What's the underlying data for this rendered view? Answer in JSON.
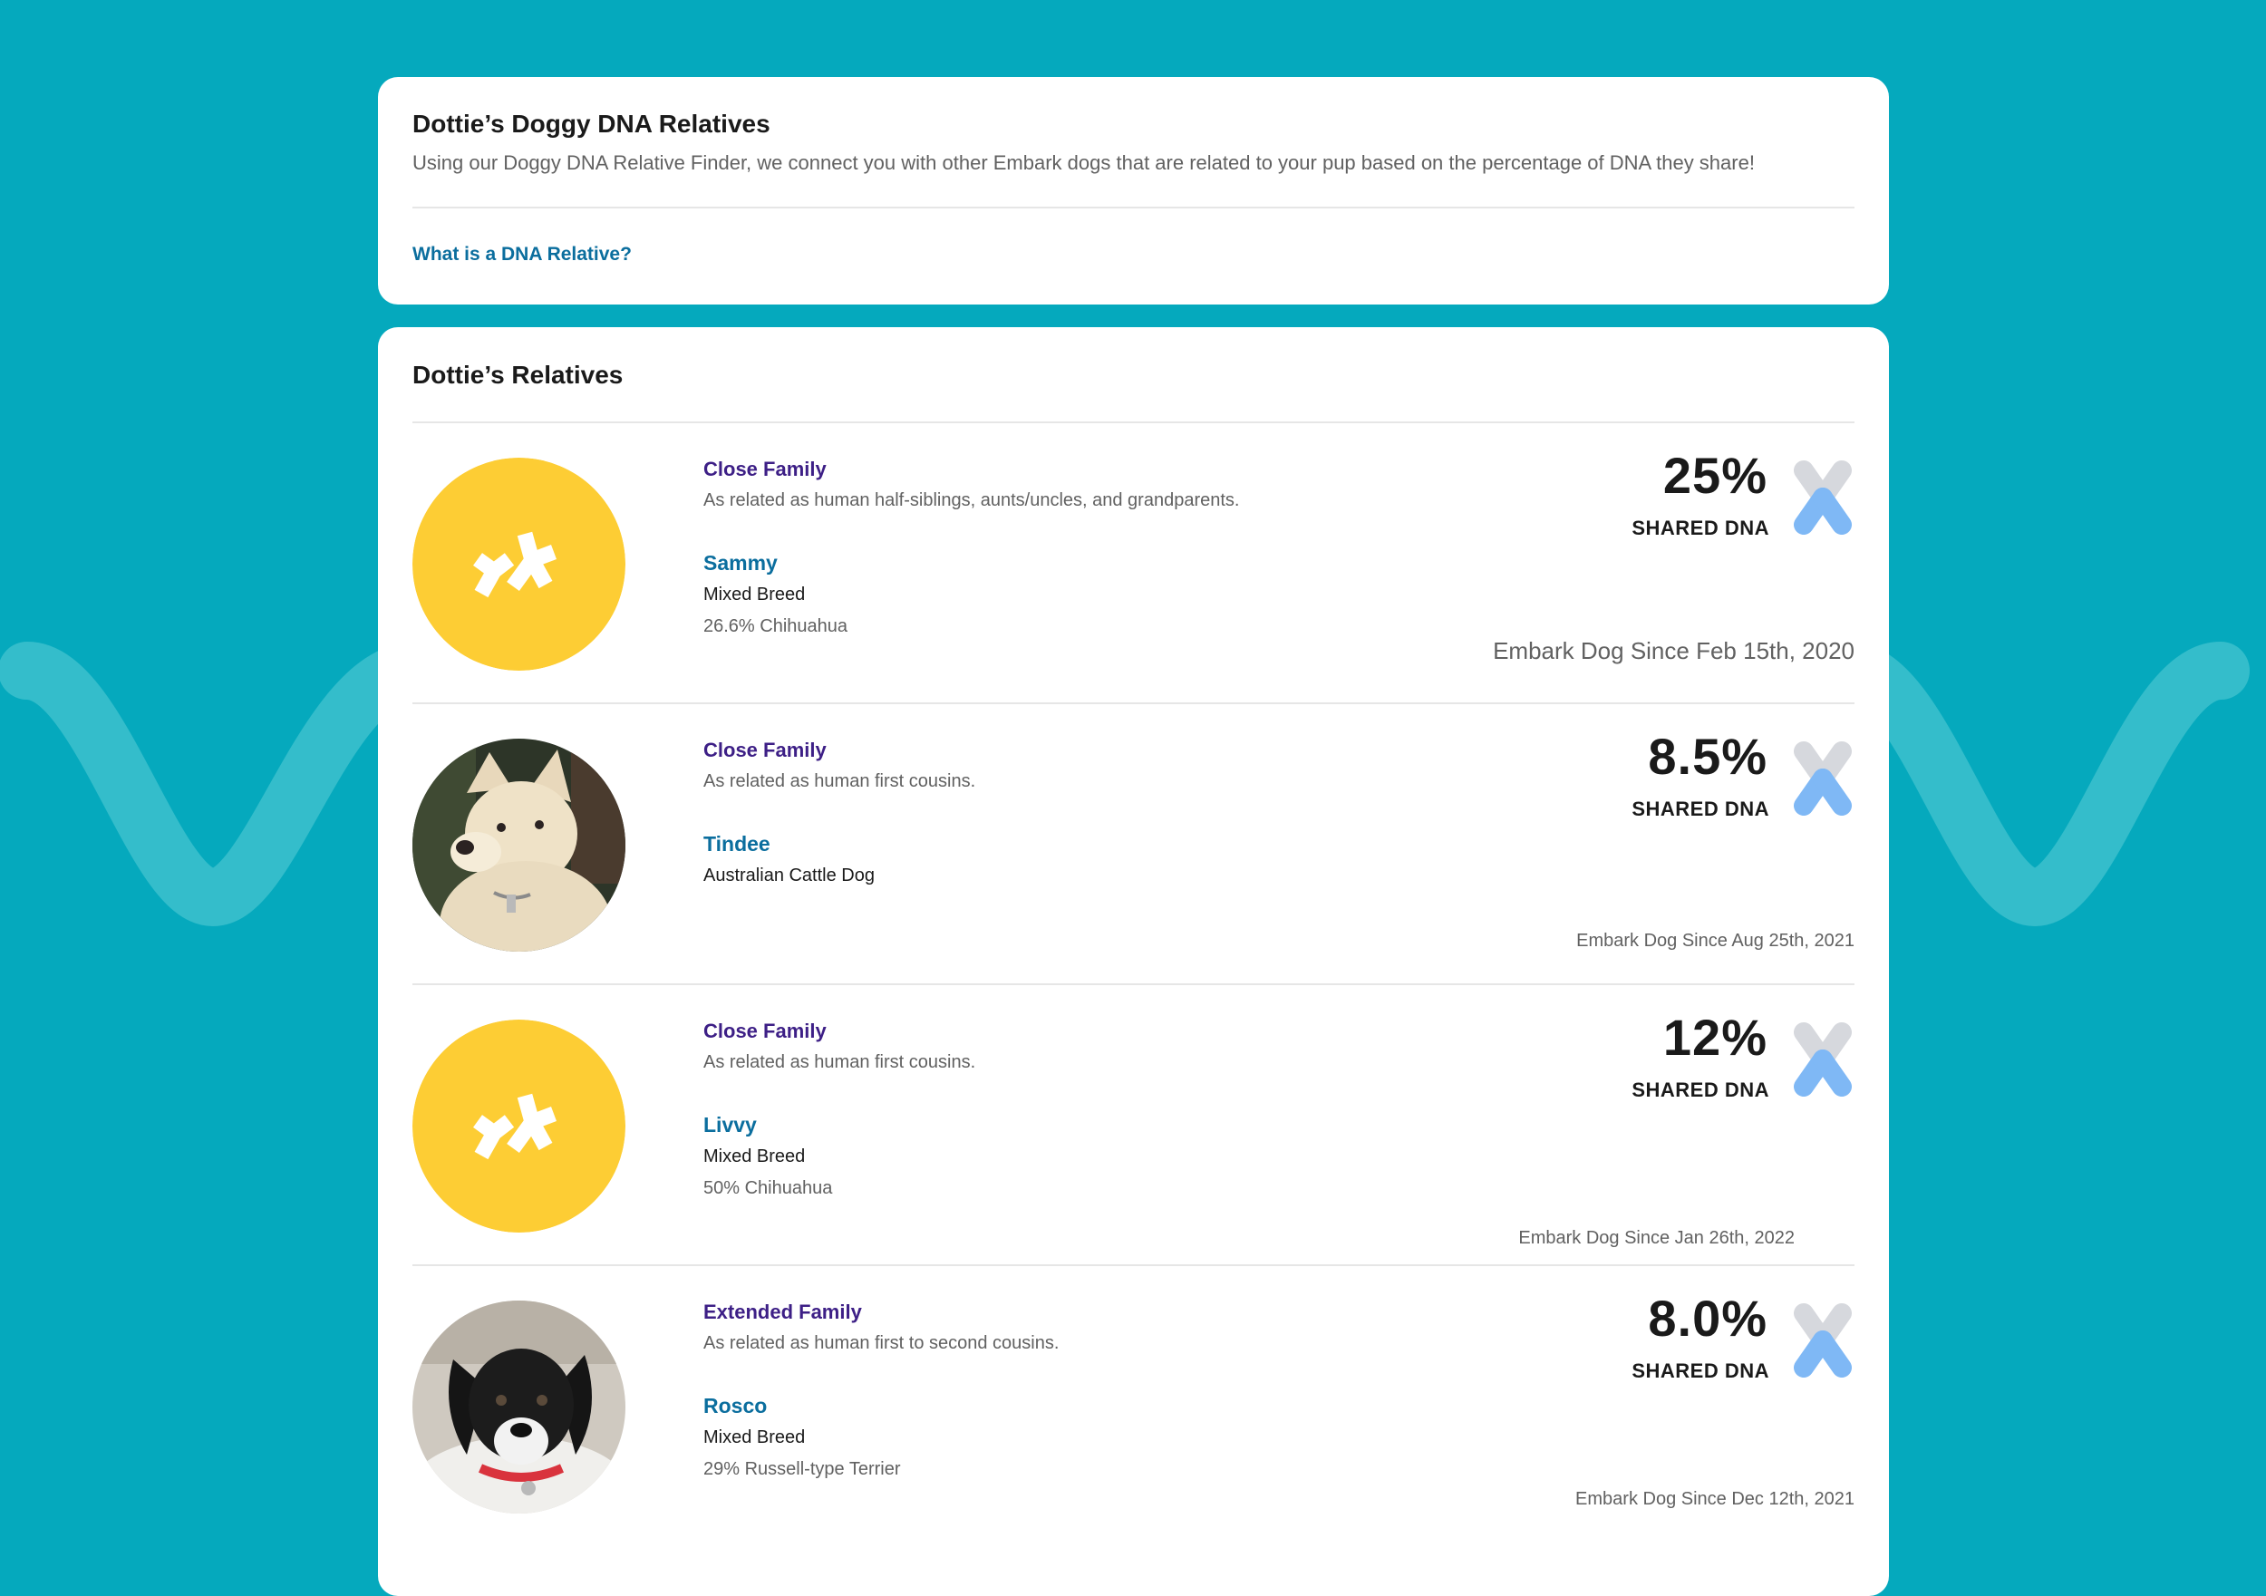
{
  "intro": {
    "title": "Dottie’s Doggy DNA Relatives",
    "description": "Using our Doggy DNA Relative Finder, we connect you with other Embark dogs that are related to your pup based on the percentage of DNA they share!",
    "link_label": "What is a DNA Relative?"
  },
  "relatives": {
    "title": "Dottie’s Relatives",
    "shared_label": "SHARED DNA",
    "items": [
      {
        "relation": "Close Family",
        "relation_desc": "As related as human half-siblings, aunts/uncles, and grandparents.",
        "name": "Sammy",
        "breed": "Mixed Breed",
        "breed_detail": "26.6% Chihuahua",
        "shared_pct": "25%",
        "since": "Embark Dog Since Feb 15th, 2020",
        "avatar": "embark-logo-icon"
      },
      {
        "relation": "Close Family",
        "relation_desc": "As related as human first cousins.",
        "name": "Tindee",
        "breed": "Australian Cattle Dog",
        "breed_detail": "",
        "shared_pct": "8.5%",
        "since": "Embark Dog Since Aug 25th, 2021",
        "avatar": "dog-photo"
      },
      {
        "relation": "Close Family",
        "relation_desc": "As related as human first cousins.",
        "name": "Livvy",
        "breed": "Mixed Breed",
        "breed_detail": "50% Chihuahua",
        "shared_pct": "12%",
        "since": "Embark Dog Since Jan 26th, 2022",
        "avatar": "embark-logo-icon"
      },
      {
        "relation": "Extended Family",
        "relation_desc": "As related as human first to second cousins.",
        "name": "Rosco",
        "breed": "Mixed Breed",
        "breed_detail": "29% Russell-type Terrier",
        "shared_pct": "8.0%",
        "since": "Embark Dog Since Dec 12th, 2021",
        "avatar": "dog-photo"
      }
    ]
  },
  "colors": {
    "background": "#05a9bd",
    "relation": "#3d1f86",
    "link": "#0b6e9e",
    "avatar_yellow": "#fdcd34",
    "chromosome_blue": "#7fb8f5",
    "chromosome_grey": "#d6d8dd"
  }
}
